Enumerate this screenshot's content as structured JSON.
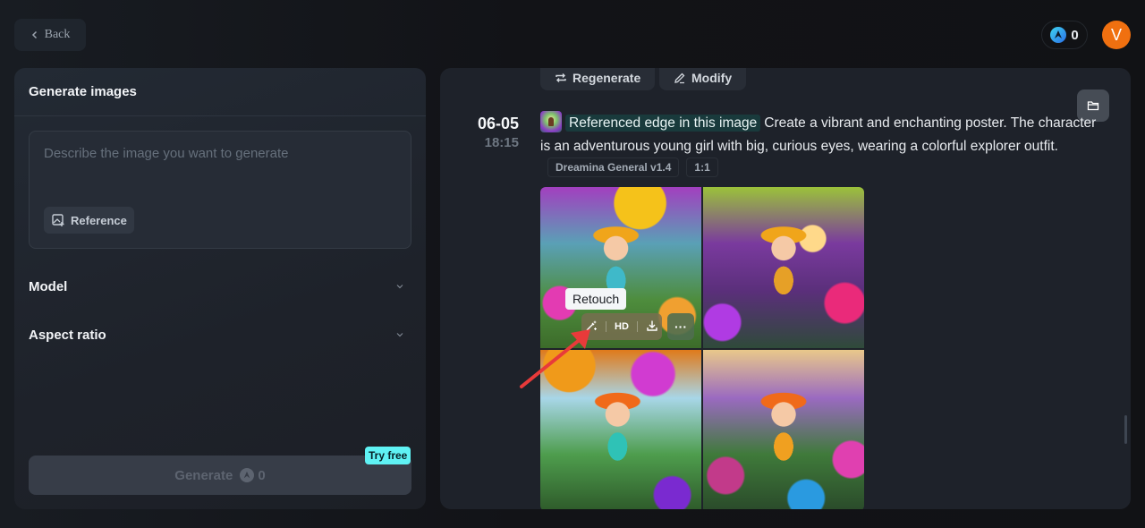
{
  "header": {
    "back_label": "Back",
    "credits": "0",
    "avatar_initial": "V",
    "avatar_color": "#f07010"
  },
  "left_panel": {
    "title": "Generate images",
    "prompt_placeholder": "Describe the image you want to generate",
    "prompt_value": "",
    "reference_label": "Reference",
    "settings": [
      {
        "label": "Model"
      },
      {
        "label": "Aspect ratio"
      }
    ],
    "generate_label": "Generate",
    "generate_cost": "0",
    "try_free_badge": "Try free",
    "try_free_color": "#5ff2f4"
  },
  "right_panel": {
    "actions": [
      {
        "label": "Regenerate",
        "icon": "regenerate-icon"
      },
      {
        "label": "Modify",
        "icon": "pencil-icon"
      }
    ],
    "entry": {
      "date": "06-05",
      "time": "18:15",
      "reference_chip": "Referenced edge in this image",
      "prompt": "Create a vibrant and enchanting poster. The character is an adventurous young girl with big, curious eyes, wearing a colorful explorer outfit.",
      "tags": [
        "Dreamina General v1.4",
        "1:1"
      ],
      "images": [
        {
          "alt": "Girl explorer in colorful forest 1"
        },
        {
          "alt": "Girl explorer in colorful forest 2"
        },
        {
          "alt": "Girl explorer in colorful forest 3"
        },
        {
          "alt": "Girl explorer in colorful forest 4"
        }
      ],
      "image_toolbar": {
        "tooltip": "Retouch",
        "hd_label": "HD",
        "more_label": "···"
      }
    }
  }
}
